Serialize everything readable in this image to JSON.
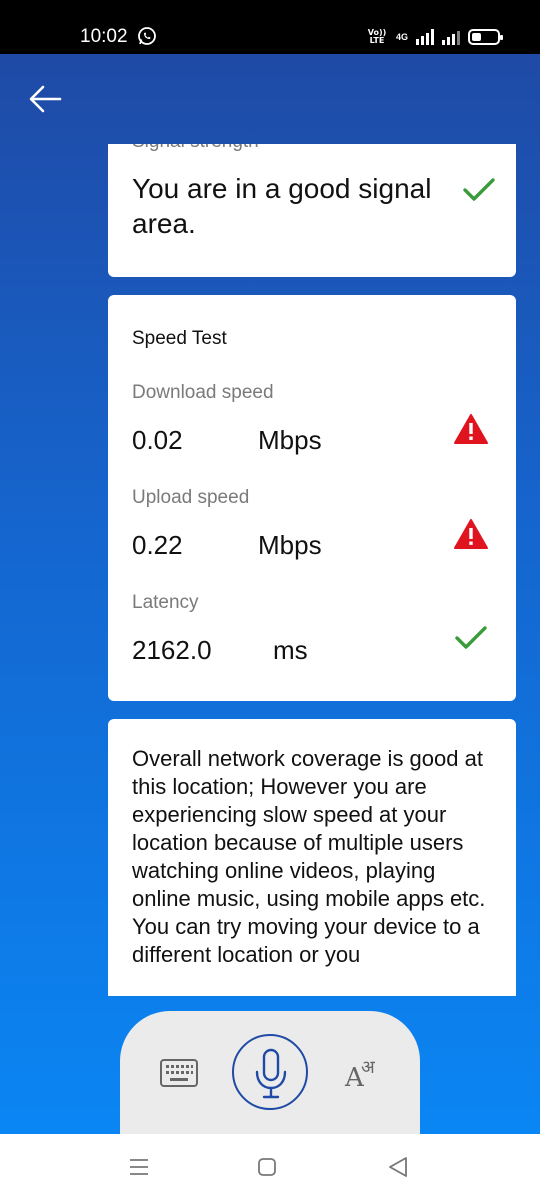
{
  "status_bar": {
    "time": "10:02",
    "volte_line1": "Vo))",
    "volte_line2": "LTE",
    "network": "4G",
    "icons": [
      "whatsapp-icon",
      "volte-icon",
      "signal-icon",
      "battery-icon"
    ]
  },
  "header": {
    "back_icon": "back-arrow-icon"
  },
  "signal_card": {
    "label": "Signal strength",
    "message": "You are in a good signal area.",
    "status_icon": "check-icon",
    "status_color": "#3a9b3a"
  },
  "speed_card": {
    "title": "Speed Test",
    "metrics": [
      {
        "label": "Download speed",
        "value": "0.02",
        "unit": "Mbps",
        "status_icon": "warning-icon"
      },
      {
        "label": "Upload speed",
        "value": "0.22",
        "unit": "Mbps",
        "status_icon": "warning-icon"
      },
      {
        "label": "Latency",
        "value": "2162.0",
        "unit": "ms",
        "status_icon": "check-icon"
      }
    ],
    "warning_color": "#e0141e",
    "ok_color": "#3a9b3a"
  },
  "advice_card": {
    "text": "Overall network coverage is good at this location; However you are experiencing slow speed at your location because of multiple users watching online videos, playing online music, using mobile apps etc. You can try moving your device to a different location or you"
  },
  "voice_panel": {
    "icons": [
      "keyboard-icon",
      "microphone-icon",
      "language-icon"
    ],
    "lang_latin": "A",
    "lang_devanagari": "अ",
    "accent_color": "#1f4aa6"
  },
  "nav_bar": {
    "icons": [
      "menu-icon",
      "home-icon",
      "back-icon"
    ]
  },
  "colors": {
    "gradient_top": "#1f4aa6",
    "gradient_bottom": "#0a86f4",
    "card_bg": "#ffffff",
    "label_gray": "#7a7a7a"
  }
}
